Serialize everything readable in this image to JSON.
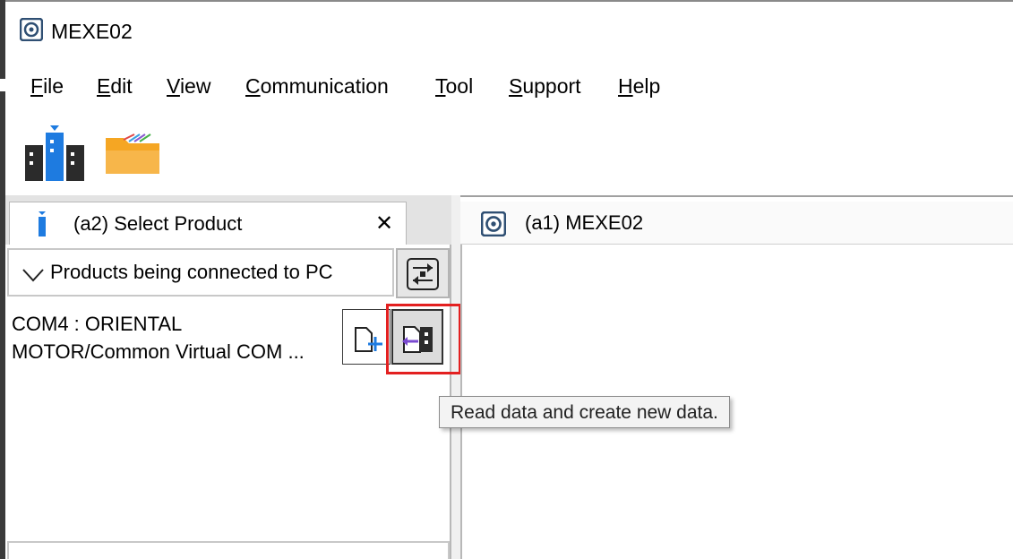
{
  "app": {
    "title": "MEXE02"
  },
  "menu": {
    "items": [
      {
        "label": "File",
        "accel": "F"
      },
      {
        "label": "Edit",
        "accel": "E"
      },
      {
        "label": "View",
        "accel": "V"
      },
      {
        "label": "Communication",
        "accel": "C"
      },
      {
        "label": "Tool",
        "accel": "T"
      },
      {
        "label": "Support",
        "accel": "S"
      },
      {
        "label": "Help",
        "accel": "H"
      }
    ]
  },
  "toolbar": {
    "icons": [
      "select-product-icon",
      "open-folder-icon"
    ]
  },
  "left_panel": {
    "tab_label": "(a2) Select Product",
    "close_glyph": "✕",
    "section_label": "Products being connected to PC",
    "connection_line1": "COM4 : ORIENTAL",
    "connection_line2": "MOTOR/Common Virtual COM ..."
  },
  "right_panel": {
    "tab_label": "(a1) MEXE02"
  },
  "tooltip": {
    "text": "Read data and create new data."
  },
  "colors": {
    "highlight": "#e32020",
    "folder": "#f5a623",
    "accent_blue": "#1e7be0"
  }
}
